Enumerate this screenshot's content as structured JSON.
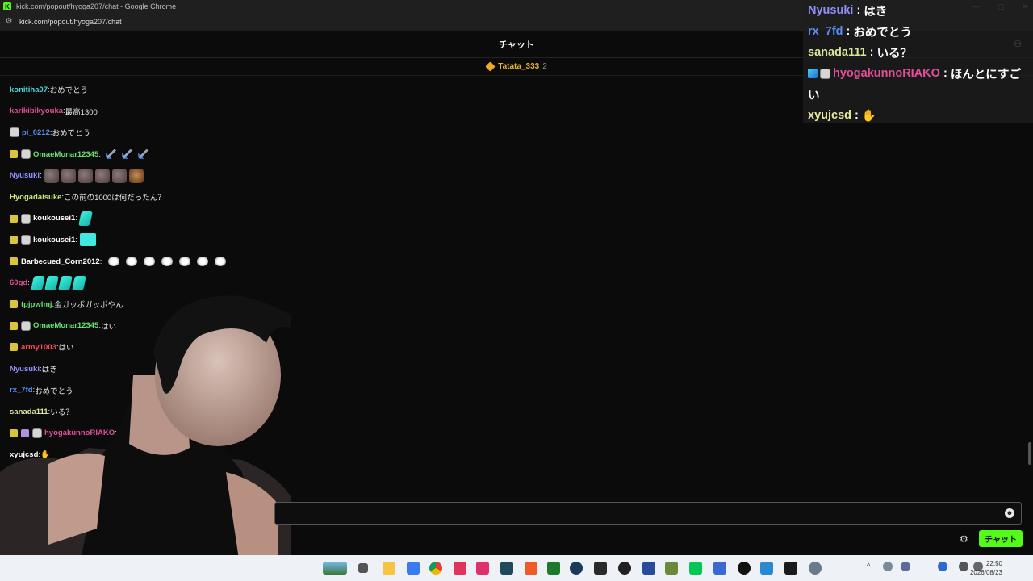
{
  "window": {
    "title": "kick.com/popout/hyoga207/chat - Google Chrome",
    "url": "kick.com/popout/hyoga207/chat"
  },
  "chat": {
    "header": "チャット",
    "pinned": {
      "user": "Tatata_333",
      "count": "2"
    },
    "messages": [
      {
        "user": "konitiha07",
        "color": "#4fd8d8",
        "sep": ": ",
        "text": "おめでとう",
        "badges": [],
        "emotes": []
      },
      {
        "user": "karikibikyouka",
        "color": "#e24f98",
        "sep": ": ",
        "text": "最高1300",
        "badges": [],
        "emotes": []
      },
      {
        "user": "pi_0212",
        "color": "#5b8cf0",
        "sep": ": ",
        "text": "おめでとう",
        "badges": [
          "mod"
        ],
        "emotes": []
      },
      {
        "user": "OmaeMonar12345",
        "color": "#68e070",
        "sep": ": ",
        "text": "",
        "badges": [
          "sub",
          "mod"
        ],
        "emotes": [
          "sword",
          "sword",
          "sword"
        ]
      },
      {
        "user": "Nyusuki",
        "color": "#8f8fff",
        "sep": ": ",
        "text": "",
        "badges": [],
        "emotes": [
          "brown",
          "brown",
          "brown",
          "brown",
          "brown",
          "face"
        ]
      },
      {
        "user": "Hyogadaisuke",
        "color": "#c8e878",
        "sep": ": ",
        "text": "この前の1000は何だったん？",
        "badges": [],
        "emotes": []
      },
      {
        "user": "koukousei1",
        "color": "#ffffff",
        "sep": ": ",
        "text": "",
        "badges": [
          "sub",
          "mod"
        ],
        "emotes": [
          "cyan"
        ]
      },
      {
        "user": "koukousei1",
        "color": "#ffffff",
        "sep": ": ",
        "text": "",
        "badges": [
          "sub",
          "mod"
        ],
        "emotes": [
          "cyanblock"
        ]
      },
      {
        "user": "Barbecued_Corn2012",
        "color": "#ffffff",
        "sep": ": ",
        "text": "",
        "badges": [
          "sub"
        ],
        "emotes": [
          "hand",
          "hand",
          "hand",
          "hand",
          "hand",
          "hand",
          "hand"
        ]
      },
      {
        "user": "60gd",
        "color": "#e24f98",
        "sep": ": ",
        "text": "",
        "badges": [],
        "emotes": [
          "cyan",
          "cyan",
          "cyan",
          "cyan"
        ]
      },
      {
        "user": "tpjpwlmj",
        "color": "#68e070",
        "sep": ": ",
        "text": "金ガッポガッポやん",
        "badges": [
          "sub"
        ],
        "emotes": []
      },
      {
        "user": "OmaeMonar12345",
        "color": "#68e070",
        "sep": ": ",
        "text": "はい",
        "badges": [
          "sub",
          "mod"
        ],
        "emotes": []
      },
      {
        "user": "army1003",
        "color": "#f05050",
        "sep": ": ",
        "text": "はい",
        "badges": [
          "sub"
        ],
        "emotes": []
      },
      {
        "user": "Nyusuki",
        "color": "#8f8fff",
        "sep": ": ",
        "text": "はき",
        "badges": [],
        "emotes": []
      },
      {
        "user": "rx_7fd",
        "color": "#5b8cf0",
        "sep": ": ",
        "text": "おめでとう",
        "badges": [],
        "emotes": []
      },
      {
        "user": "sanada111",
        "color": "#d8e8a0",
        "sep": ": ",
        "text": "いる？",
        "badges": [],
        "emotes": []
      },
      {
        "user": "hyogakunnoRIAKO",
        "color": "#e24f98",
        "sep": ": ",
        "text": "ほんとにすご",
        "badges": [
          "sub",
          "gift",
          "mod"
        ],
        "emotes": []
      },
      {
        "user": "xyujcsd",
        "color": "#ffffff",
        "sep": ": ",
        "text": "✋",
        "badges": [],
        "emotes": []
      }
    ],
    "input_placeholder": "",
    "send_label": "チャット"
  },
  "overlay": [
    {
      "user": "Nyusuki",
      "color": "#8f8fff",
      "sep": " : ",
      "text": "はき",
      "badges": []
    },
    {
      "user": "rx_7fd",
      "color": "#5b8cf0",
      "sep": " : ",
      "text": "おめでとう",
      "badges": []
    },
    {
      "user": "sanada111",
      "color": "#d8e8a0",
      "sep": " : ",
      "text": "いる？",
      "badges": []
    },
    {
      "user": "hyogakunnoRIAKO",
      "color": "#e24f98",
      "sep": " : ",
      "text": "ほんとにすご",
      "badges": [
        "cube",
        "mod"
      ]
    },
    {
      "user": "",
      "color": "#ffffff",
      "sep": "",
      "text": "い",
      "badges": []
    },
    {
      "user": "xyujcsd",
      "color": "#e8e8a0",
      "sep": " : ",
      "text": "✋",
      "badges": []
    }
  ],
  "taskbar": {
    "time": "22:50",
    "date": "2026/08/23"
  }
}
